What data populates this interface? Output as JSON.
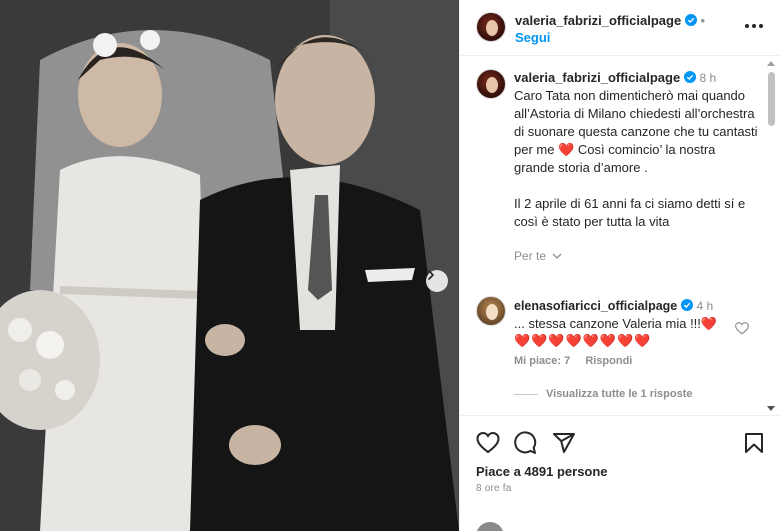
{
  "post": {
    "image_description_icon": "photo",
    "next_icon": "chevron-right-icon"
  },
  "header": {
    "username": "valeria_fabrizi_officialpage",
    "follow_label": "Segui",
    "more_icon": "more-horizontal-icon"
  },
  "caption": {
    "username": "valeria_fabrizi_officialpage",
    "time": "8 h",
    "text_line1": "Caro Tata non dimenticherò mai quando all’Astoria di Milano chiedesti all’orchestra di suonare questa canzone che tu cantasti per me",
    "heart": "❤️",
    "text_line2": " Così comincio’ la nostra grande storia d’amore .",
    "text_para2": "Il 2 aprile di 61 anni fa ci siamo detti sí e così è stato per tutta la vita",
    "see_translation": "Per te"
  },
  "comment": {
    "username": "elenasofiaricci_officialpage",
    "time": "4 h",
    "text": "... stessa canzone Valeria mia !!!",
    "hearts": "❤️❤️❤️❤️❤️❤️❤️❤️",
    "likes": "Mi piace: 7",
    "reply": "Rispondi",
    "view_replies": "Visualizza tutte le 1 risposte"
  },
  "actions": {
    "likes_text": "Piace a 4891 persone",
    "time_ago": "8 ore fa"
  },
  "colors": {
    "accent": "#0095f6",
    "heart": "#ed4956",
    "verified": "#0095f6"
  }
}
